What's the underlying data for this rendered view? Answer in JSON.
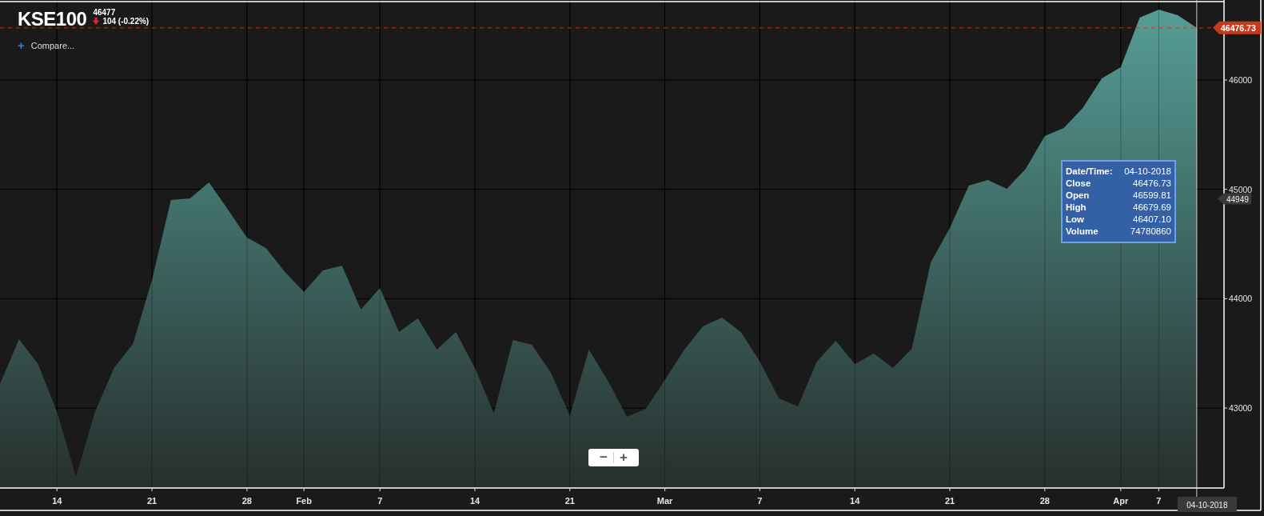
{
  "header": {
    "price": "46477",
    "change": "104 (-0.22%)",
    "compare_icon": "+",
    "compare": "Compare..."
  },
  "chart": {
    "chart_data": {
      "type": "area",
      "categories": [
        null,
        null,
        null,
        "14",
        null,
        null,
        null,
        null,
        "21",
        null,
        null,
        null,
        null,
        "28",
        null,
        null,
        "Feb",
        null,
        null,
        null,
        "7",
        null,
        null,
        null,
        null,
        "14",
        null,
        null,
        null,
        null,
        "21",
        null,
        null,
        null,
        null,
        "Mar",
        null,
        null,
        null,
        null,
        "7",
        null,
        null,
        null,
        null,
        "14",
        null,
        null,
        null,
        null,
        "21",
        null,
        null,
        null,
        null,
        "28",
        null,
        null,
        null,
        "Apr",
        null,
        "7",
        null,
        null
      ],
      "series": [
        {
          "name": "KSE100",
          "color": "#5aa8a0",
          "values": [
            43220,
            43630,
            43403,
            42964,
            42372,
            42964,
            43367,
            43586,
            44171,
            44903,
            44917,
            45063,
            44815,
            44559,
            44464,
            44244,
            44061,
            44259,
            44303,
            43901,
            44098,
            43696,
            43820,
            43535,
            43696,
            43367,
            42950,
            43623,
            43579,
            43323,
            42928,
            43535,
            43250,
            42920,
            42994,
            43257,
            43528,
            43747,
            43827,
            43696,
            43425,
            43089,
            43015,
            43425,
            43615,
            43403,
            43498,
            43367,
            43542,
            44332,
            44647,
            45034,
            45086,
            45005,
            45188,
            45488,
            45561,
            45744,
            46015,
            46117,
            46571,
            46644,
            46593,
            46477
          ]
        }
      ],
      "ylim": [
        42269,
        46731
      ],
      "yticks": [
        43000,
        44000,
        45000,
        46000
      ],
      "grid": true,
      "ref_lines": [
        {
          "axis": "y",
          "value": 46476.73,
          "label": "46476.73",
          "color": "#c8391c"
        }
      ]
    },
    "crosshair_label": "44949",
    "crosshair_date": "04-10-2018",
    "tooltip": {
      "rows": [
        {
          "label": "Date/Time:",
          "value": "04-10-2018"
        },
        {
          "label": "Close",
          "value": "46476.73"
        },
        {
          "label": "Open",
          "value": "46599.81"
        },
        {
          "label": "High",
          "value": "46679.69"
        },
        {
          "label": "Low",
          "value": "46407.10"
        },
        {
          "label": "Volume",
          "value": "74780860"
        }
      ]
    },
    "zoom": {
      "out": "−",
      "in": "+"
    }
  }
}
